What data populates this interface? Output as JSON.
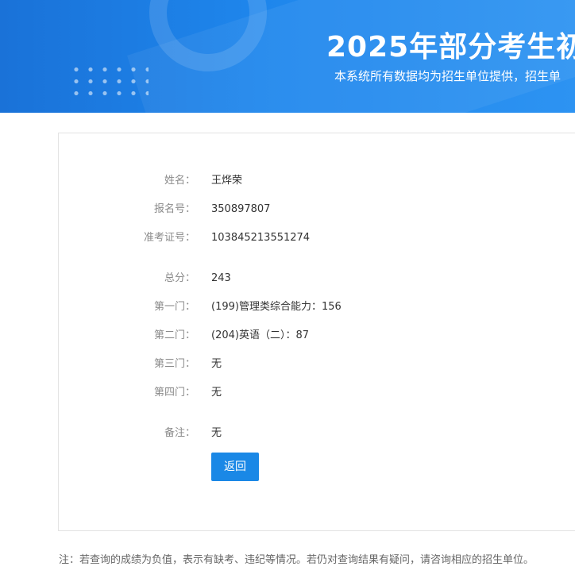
{
  "banner": {
    "title": "2025年部分考生初",
    "subtitle": "本系统所有数据均为招生单位提供，招生单"
  },
  "result": {
    "rows": [
      {
        "label": "姓名：",
        "value": "王烨荣"
      },
      {
        "label": "报名号：",
        "value": "350897807"
      },
      {
        "label": "准考证号：",
        "value": "103845213551274"
      },
      {
        "label": "总分：",
        "value": "243"
      },
      {
        "label": "第一门：",
        "value": "(199)管理类综合能力：156"
      },
      {
        "label": "第二门：",
        "value": "(204)英语（二）：87"
      },
      {
        "label": "第三门：",
        "value": "无"
      },
      {
        "label": "第四门：",
        "value": "无"
      },
      {
        "label": "备注：",
        "value": "无"
      }
    ],
    "back_label": "返回"
  },
  "footer": {
    "note": "注：若查询的成绩为负值，表示有缺考、违纪等情况。若仍对查询结果有疑问，请咨询相应的招生单位。"
  },
  "colors": {
    "banner": "#1e86ec",
    "button": "#1a88e6"
  }
}
